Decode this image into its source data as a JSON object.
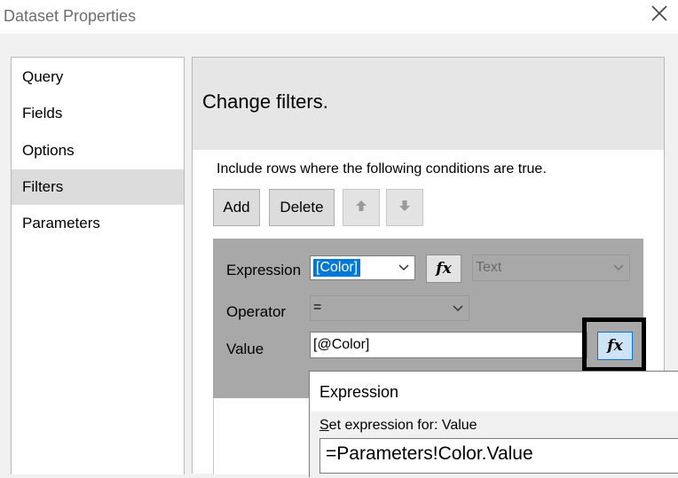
{
  "window": {
    "title": "Dataset Properties"
  },
  "nav": {
    "items": [
      {
        "label": "Query"
      },
      {
        "label": "Fields"
      },
      {
        "label": "Options"
      },
      {
        "label": "Filters"
      },
      {
        "label": "Parameters"
      }
    ],
    "active": "Filters"
  },
  "header": {
    "title": "Change filters."
  },
  "filters": {
    "instruction": "Include rows where the following conditions are true.",
    "add_label": "Add",
    "delete_label": "Delete",
    "expression_label": "Expression",
    "expression_value": "[Color]",
    "type_value": "Text",
    "operator_label": "Operator",
    "operator_value": "=",
    "value_label": "Value",
    "value_value": "[@Color]",
    "fx_label": "fx"
  },
  "expression_dialog": {
    "title": "Expression",
    "set_label": "Set expression for: Value",
    "set_label_accesskey": "S",
    "set_label_rest": "et expression for: Value",
    "expression": "=Parameters!Color.Value"
  },
  "colors": {
    "selection": "#0078d7",
    "panel": "#a8a8a8",
    "active_nav": "#dcdcdc",
    "header": "#e6e6e6"
  },
  "icons": [
    "close-icon",
    "arrow-up-icon",
    "arrow-down-icon",
    "chevron-down-icon",
    "fx-icon"
  ]
}
